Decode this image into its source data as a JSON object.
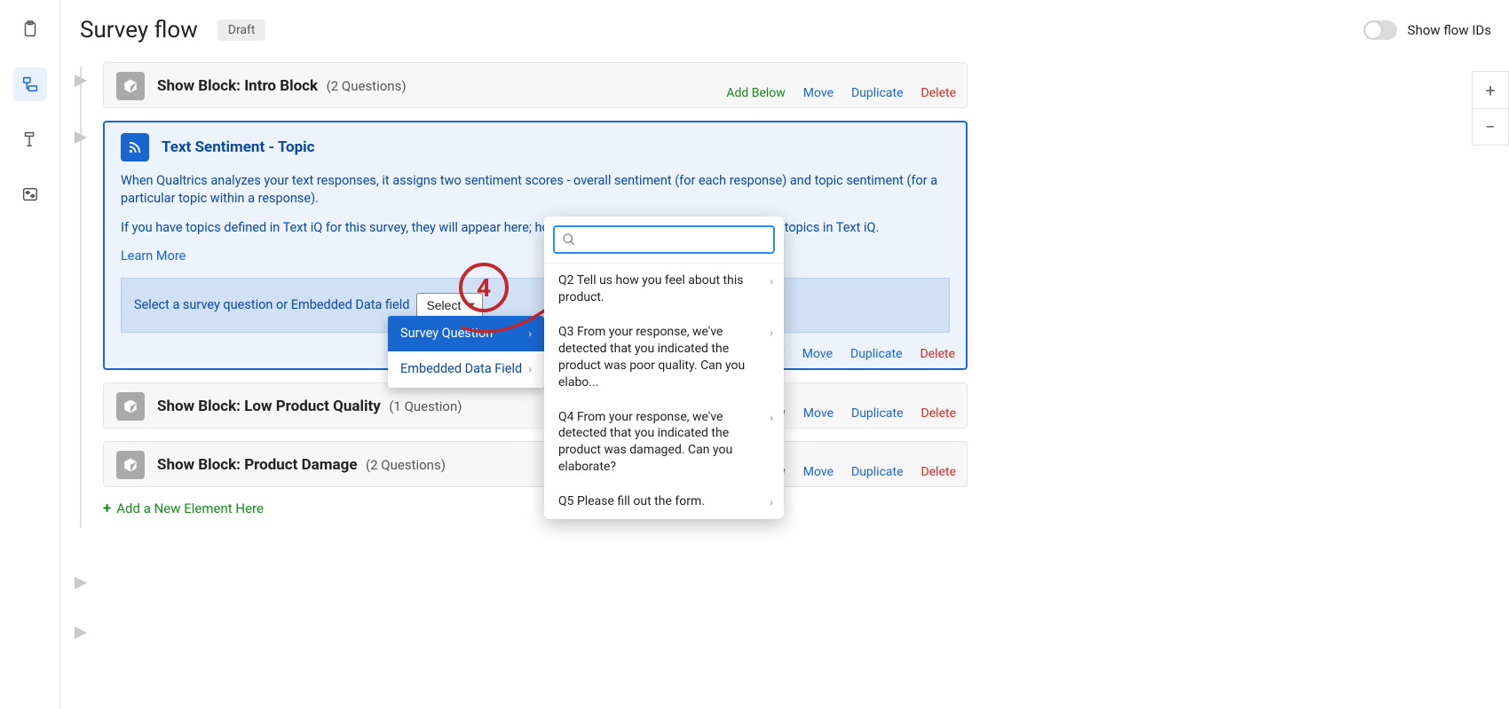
{
  "header": {
    "title": "Survey flow",
    "status": "Draft",
    "toggle_label": "Show flow IDs"
  },
  "blocks": [
    {
      "title": "Show Block: Intro Block",
      "count_label": "(2 Questions)"
    },
    {
      "title": "Show Block: Low Product Quality",
      "count_label": "(1 Question)"
    },
    {
      "title": "Show Block: Product Damage",
      "count_label": "(2 Questions)"
    }
  ],
  "sentiment": {
    "title": "Text Sentiment - Topic",
    "p1": "When Qualtrics analyzes your text responses, it assigns two sentiment scores - overall sentiment (for each response) and topic sentiment (for a particular topic within a response).",
    "p2": "If you have topics defined in Text iQ for this survey, they will appear here; however, changes made here will not affect topics in Text iQ.",
    "learn_more": "Learn More",
    "selector_label": "Select a survey question or Embedded Data field",
    "select_button": "Select"
  },
  "dd1": {
    "opt1": "Survey Question",
    "opt2": "Embedded Data Field"
  },
  "dd2": {
    "search_placeholder": "",
    "items": [
      "Q2 Tell us how you feel about this product.",
      "Q3 From your response, we've detected that you indicated the product was poor quality. Can you elabo...",
      "Q4 From your response, we've detected that you indicated the product was damaged. Can you elaborate?",
      "Q5 Please fill out the form."
    ]
  },
  "callout_number": "4",
  "actions": {
    "add": "Add Below",
    "move": "Move",
    "dup": "Duplicate",
    "del": "Delete"
  },
  "add_row": "Add a New Element Here"
}
